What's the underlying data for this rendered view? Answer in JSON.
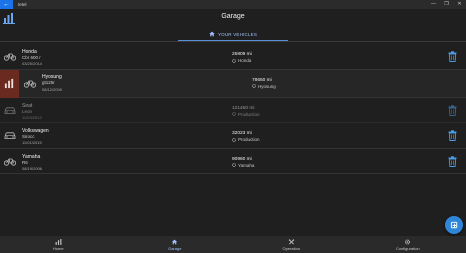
{
  "window": {
    "back_glyph": "←",
    "title": "tetel",
    "controls": [
      "—",
      "❐",
      "✕"
    ]
  },
  "header": {
    "title": "Garage",
    "tab_label": "YOUR VEHICLES",
    "tab_icon": "home-icon"
  },
  "vehicles": [
    {
      "type_icon": "bike-icon",
      "make": "Honda",
      "model": "Cbr 600 r",
      "date": "03/25/2014",
      "mileage": "25809 mi",
      "garage": "Honda",
      "state": "normal"
    },
    {
      "type_icon": "bike-icon",
      "make": "Hyosung",
      "model": "gt125r",
      "date": "08/12/2009",
      "mileage": "78650 mi",
      "garage": "Hyosung",
      "state": "selected"
    },
    {
      "type_icon": "car-icon",
      "make": "Seat",
      "model": "Leon",
      "date": "11/03/2012",
      "mileage": "121450 mi",
      "garage": "Production",
      "state": "dim"
    },
    {
      "type_icon": "car-icon",
      "make": "Volkswagen",
      "model": "Sirocc",
      "date": "11/01/2015",
      "mileage": "32023 mi",
      "garage": "Production",
      "state": "normal"
    },
    {
      "type_icon": "bike-icon",
      "make": "Yamaha",
      "model": "R6",
      "date": "08/19/2006",
      "mileage": "90960 mi",
      "garage": "Yamaha",
      "state": "normal"
    }
  ],
  "nav": [
    {
      "label": "Home",
      "icon": "chart-icon",
      "active": false
    },
    {
      "label": "Garage",
      "icon": "home-icon",
      "active": true
    },
    {
      "label": "Operation",
      "icon": "tools-icon",
      "active": false
    },
    {
      "label": "Configuration",
      "icon": "gear-icon",
      "active": false
    }
  ],
  "colors": {
    "accent": "#2f86d8",
    "tab_text": "#9ec0ff",
    "selected_strip": "#6b2a20",
    "delete": "#4a9be8"
  }
}
